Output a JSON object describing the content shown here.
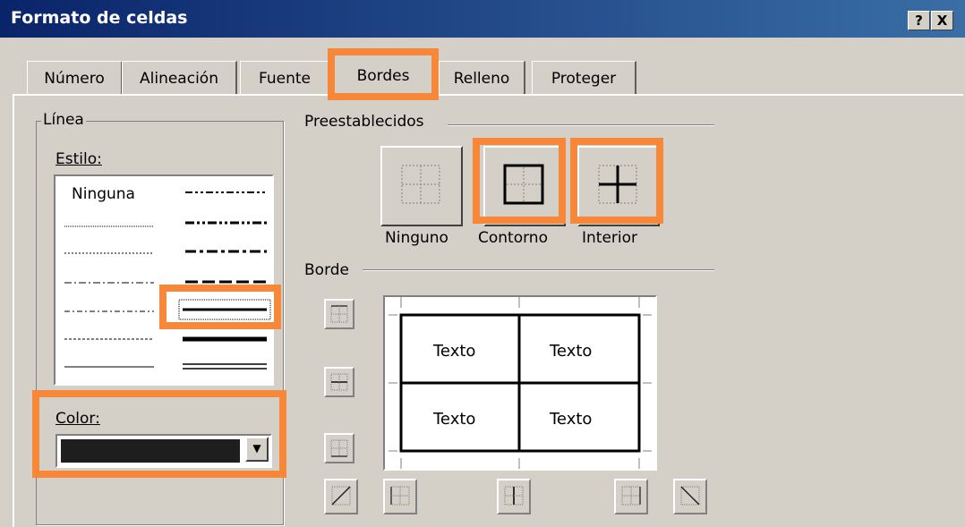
{
  "window": {
    "title": "Formato de celdas",
    "help_button": "?",
    "close_button": "X"
  },
  "tabs": [
    {
      "label": "Número"
    },
    {
      "label": "Alineación"
    },
    {
      "label": "Fuente"
    },
    {
      "label": "Bordes",
      "active": true
    },
    {
      "label": "Relleno"
    },
    {
      "label": "Proteger"
    }
  ],
  "linea": {
    "group_label": "Línea",
    "estilo_label": "Estilo:",
    "styles_left": [
      "Ninguna",
      "dotted-fine",
      "dashed-fine",
      "dash-dot-long",
      "dash-dot",
      "dashed-small",
      "solid-thin"
    ],
    "styles_right": [
      "dash-dot-dot",
      "dash-dot-dot-medium",
      "dash-dot-medium",
      "dashed-medium",
      "solid-medium (selected)",
      "solid-thick",
      "double"
    ],
    "color_label": "Color:",
    "color_value": "#1e1e1e"
  },
  "preestablecidos": {
    "section_label": "Preestablecidos",
    "buttons": [
      {
        "label": "Ninguno",
        "icon": "preset-none-icon"
      },
      {
        "label": "Contorno",
        "icon": "preset-outline-icon"
      },
      {
        "label": "Interior",
        "icon": "preset-inside-icon"
      }
    ]
  },
  "borde": {
    "section_label": "Borde",
    "preview_cells": [
      "Texto",
      "Texto",
      "Texto",
      "Texto"
    ]
  },
  "highlight_color": "#f7883a"
}
